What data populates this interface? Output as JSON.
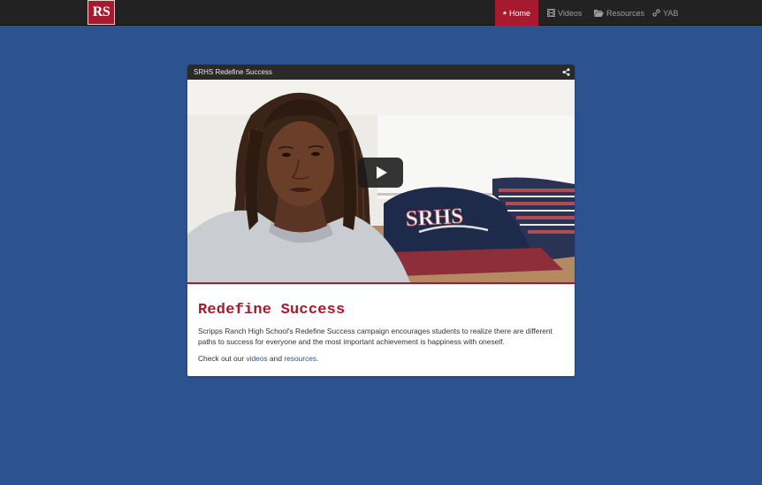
{
  "brand": {
    "logo_text": "RS"
  },
  "nav": {
    "items": [
      {
        "label": "Home",
        "icon": "home-icon",
        "active": true
      },
      {
        "label": "Videos",
        "icon": "film-icon",
        "active": false
      },
      {
        "label": "Resources",
        "icon": "folder-open-icon",
        "active": false
      },
      {
        "label": "YAB",
        "icon": "link-icon",
        "active": false
      }
    ]
  },
  "video": {
    "title": "SRHS Redefine Success",
    "shirt_text": "SRHS"
  },
  "card": {
    "title": "Redefine Success",
    "description": "Scripps Ranch High School's Redefine Success campaign encourages students to realize there are different paths to success for everyone and the most important achievement is happiness with oneself.",
    "cta_prefix": "Check out our ",
    "cta_link1": "videos",
    "cta_middle": " and ",
    "cta_link2": "resources",
    "cta_suffix": "."
  },
  "colors": {
    "background": "#2c5390",
    "navbar": "#222222",
    "accent": "#a6192e"
  }
}
